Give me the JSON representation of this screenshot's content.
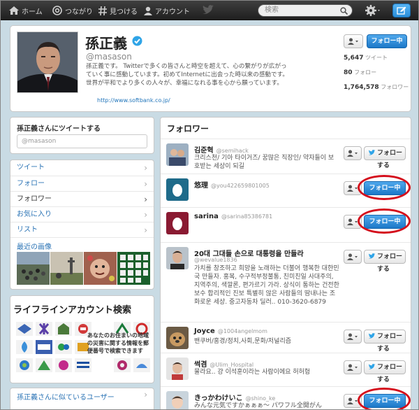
{
  "topbar": {
    "home": "ホーム",
    "connect": "つながり",
    "discover": "見つける",
    "account": "アカウント",
    "search_placeholder": "検索"
  },
  "profile": {
    "name": "孫正義",
    "handle": "@masason",
    "bio": "孫正義です。 Twitterで多くの皆さんと時空を超えて、心の繋がりが広がっていく事に感動しています。初めてInternetに出会った時以来の感動です。世界が平和でより多くの人々が、幸福になれる事を心から願っています。",
    "url": "http://www.softbank.co.jp/",
    "follow_label": "フォロー中",
    "stats": [
      {
        "value": "5,647",
        "label": "ツイート"
      },
      {
        "value": "80",
        "label": "フォロー"
      },
      {
        "value": "1,764,578",
        "label": "フォロワー"
      }
    ]
  },
  "sidebar": {
    "tweet_to_title": "孫正義さんにツイートする",
    "tweet_to_placeholder": "@masason",
    "menu": [
      {
        "label": "ツイート"
      },
      {
        "label": "フォロー"
      },
      {
        "label": "フォロワー"
      },
      {
        "label": "お気に入り"
      },
      {
        "label": "リスト"
      }
    ],
    "photos_label": "最近の画像",
    "banner_title": "ライフラインアカウント検索",
    "banner_text": "あなたのお住まいの地域の災害に関する情報を郵便番号で検索できます",
    "similar_title": "孫正義さんに似ているユーザー"
  },
  "followers": {
    "title": "フォロワー",
    "follow_label": "フォローする",
    "following_label": "フォロー中",
    "rows": [
      {
        "name": "김준혁",
        "handle": "@semihack",
        "bio": "크리스천/ 기아 타이거즈/ 꿈많은 직장인/ 약자들이 보호받는 세상이 되길",
        "state": "follow"
      },
      {
        "name": "悠理",
        "handle": "@you422659801005",
        "bio": "",
        "state": "following"
      },
      {
        "name": "sarina",
        "handle": "@sarina85386781",
        "bio": "",
        "state": "following"
      },
      {
        "name": "20대 그대들 손으로 대통령을 만들라",
        "handle": "@wevalue1836",
        "bio": "가치를 창조하고 희망을 노래하는 더불어 행복한 대한민국 만들자. 홍복, 수구적부정불통, 친미친일 사대주의, 지역주의, 색깔론, 편가르기 가라. 상식이 통하는 건전한 보수 합리적인 진보 특별히 않은 사람들의 땀내나는 조화로운 세상. 중고자동차 딜러.. 010-3620-6879",
        "state": "follow"
      },
      {
        "name": "Joyce",
        "handle": "@1004angelmom",
        "bio": "밴쿠버/홍경/정치,사회,문화/저널리즘",
        "state": "follow"
      },
      {
        "name": "썩겸",
        "handle": "@Ulim_Hospital",
        "bio": "물라요.. 걍 이석훈이라는 사람이에요 허허헝",
        "state": "follow"
      },
      {
        "name": "きっかわけいこ",
        "handle": "@shino_ke",
        "bio": "みんな元気ですかぁぁぁ～ パワフル全開がん",
        "state": "following"
      }
    ]
  },
  "colors": {
    "accent": "#2a73b5",
    "follow_blue": "#1c78c8",
    "highlight_ring": "#d40e1c",
    "background": "#c9dbe4"
  }
}
